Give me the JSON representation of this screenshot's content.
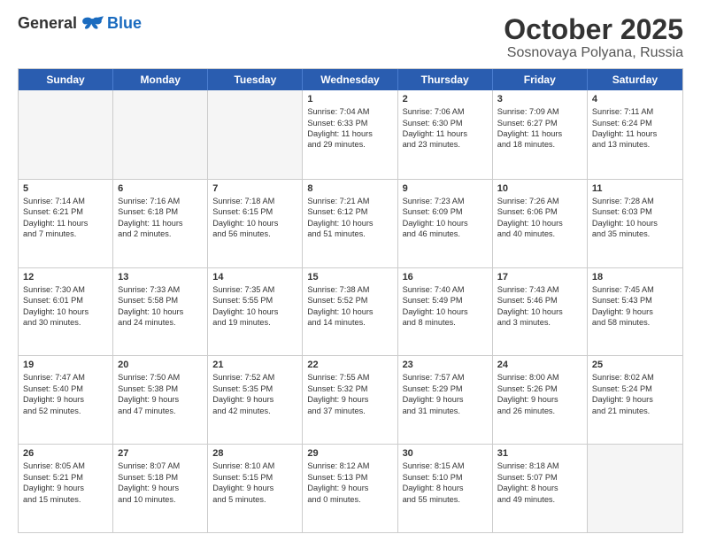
{
  "logo": {
    "general": "General",
    "blue": "Blue"
  },
  "header": {
    "month": "October 2025",
    "location": "Sosnovaya Polyana, Russia"
  },
  "weekdays": [
    "Sunday",
    "Monday",
    "Tuesday",
    "Wednesday",
    "Thursday",
    "Friday",
    "Saturday"
  ],
  "rows": [
    [
      {
        "day": "",
        "lines": [],
        "empty": true
      },
      {
        "day": "",
        "lines": [],
        "empty": true
      },
      {
        "day": "",
        "lines": [],
        "empty": true
      },
      {
        "day": "1",
        "lines": [
          "Sunrise: 7:04 AM",
          "Sunset: 6:33 PM",
          "Daylight: 11 hours",
          "and 29 minutes."
        ],
        "empty": false
      },
      {
        "day": "2",
        "lines": [
          "Sunrise: 7:06 AM",
          "Sunset: 6:30 PM",
          "Daylight: 11 hours",
          "and 23 minutes."
        ],
        "empty": false
      },
      {
        "day": "3",
        "lines": [
          "Sunrise: 7:09 AM",
          "Sunset: 6:27 PM",
          "Daylight: 11 hours",
          "and 18 minutes."
        ],
        "empty": false
      },
      {
        "day": "4",
        "lines": [
          "Sunrise: 7:11 AM",
          "Sunset: 6:24 PM",
          "Daylight: 11 hours",
          "and 13 minutes."
        ],
        "empty": false
      }
    ],
    [
      {
        "day": "5",
        "lines": [
          "Sunrise: 7:14 AM",
          "Sunset: 6:21 PM",
          "Daylight: 11 hours",
          "and 7 minutes."
        ],
        "empty": false
      },
      {
        "day": "6",
        "lines": [
          "Sunrise: 7:16 AM",
          "Sunset: 6:18 PM",
          "Daylight: 11 hours",
          "and 2 minutes."
        ],
        "empty": false
      },
      {
        "day": "7",
        "lines": [
          "Sunrise: 7:18 AM",
          "Sunset: 6:15 PM",
          "Daylight: 10 hours",
          "and 56 minutes."
        ],
        "empty": false
      },
      {
        "day": "8",
        "lines": [
          "Sunrise: 7:21 AM",
          "Sunset: 6:12 PM",
          "Daylight: 10 hours",
          "and 51 minutes."
        ],
        "empty": false
      },
      {
        "day": "9",
        "lines": [
          "Sunrise: 7:23 AM",
          "Sunset: 6:09 PM",
          "Daylight: 10 hours",
          "and 46 minutes."
        ],
        "empty": false
      },
      {
        "day": "10",
        "lines": [
          "Sunrise: 7:26 AM",
          "Sunset: 6:06 PM",
          "Daylight: 10 hours",
          "and 40 minutes."
        ],
        "empty": false
      },
      {
        "day": "11",
        "lines": [
          "Sunrise: 7:28 AM",
          "Sunset: 6:03 PM",
          "Daylight: 10 hours",
          "and 35 minutes."
        ],
        "empty": false
      }
    ],
    [
      {
        "day": "12",
        "lines": [
          "Sunrise: 7:30 AM",
          "Sunset: 6:01 PM",
          "Daylight: 10 hours",
          "and 30 minutes."
        ],
        "empty": false
      },
      {
        "day": "13",
        "lines": [
          "Sunrise: 7:33 AM",
          "Sunset: 5:58 PM",
          "Daylight: 10 hours",
          "and 24 minutes."
        ],
        "empty": false
      },
      {
        "day": "14",
        "lines": [
          "Sunrise: 7:35 AM",
          "Sunset: 5:55 PM",
          "Daylight: 10 hours",
          "and 19 minutes."
        ],
        "empty": false
      },
      {
        "day": "15",
        "lines": [
          "Sunrise: 7:38 AM",
          "Sunset: 5:52 PM",
          "Daylight: 10 hours",
          "and 14 minutes."
        ],
        "empty": false
      },
      {
        "day": "16",
        "lines": [
          "Sunrise: 7:40 AM",
          "Sunset: 5:49 PM",
          "Daylight: 10 hours",
          "and 8 minutes."
        ],
        "empty": false
      },
      {
        "day": "17",
        "lines": [
          "Sunrise: 7:43 AM",
          "Sunset: 5:46 PM",
          "Daylight: 10 hours",
          "and 3 minutes."
        ],
        "empty": false
      },
      {
        "day": "18",
        "lines": [
          "Sunrise: 7:45 AM",
          "Sunset: 5:43 PM",
          "Daylight: 9 hours",
          "and 58 minutes."
        ],
        "empty": false
      }
    ],
    [
      {
        "day": "19",
        "lines": [
          "Sunrise: 7:47 AM",
          "Sunset: 5:40 PM",
          "Daylight: 9 hours",
          "and 52 minutes."
        ],
        "empty": false
      },
      {
        "day": "20",
        "lines": [
          "Sunrise: 7:50 AM",
          "Sunset: 5:38 PM",
          "Daylight: 9 hours",
          "and 47 minutes."
        ],
        "empty": false
      },
      {
        "day": "21",
        "lines": [
          "Sunrise: 7:52 AM",
          "Sunset: 5:35 PM",
          "Daylight: 9 hours",
          "and 42 minutes."
        ],
        "empty": false
      },
      {
        "day": "22",
        "lines": [
          "Sunrise: 7:55 AM",
          "Sunset: 5:32 PM",
          "Daylight: 9 hours",
          "and 37 minutes."
        ],
        "empty": false
      },
      {
        "day": "23",
        "lines": [
          "Sunrise: 7:57 AM",
          "Sunset: 5:29 PM",
          "Daylight: 9 hours",
          "and 31 minutes."
        ],
        "empty": false
      },
      {
        "day": "24",
        "lines": [
          "Sunrise: 8:00 AM",
          "Sunset: 5:26 PM",
          "Daylight: 9 hours",
          "and 26 minutes."
        ],
        "empty": false
      },
      {
        "day": "25",
        "lines": [
          "Sunrise: 8:02 AM",
          "Sunset: 5:24 PM",
          "Daylight: 9 hours",
          "and 21 minutes."
        ],
        "empty": false
      }
    ],
    [
      {
        "day": "26",
        "lines": [
          "Sunrise: 8:05 AM",
          "Sunset: 5:21 PM",
          "Daylight: 9 hours",
          "and 15 minutes."
        ],
        "empty": false
      },
      {
        "day": "27",
        "lines": [
          "Sunrise: 8:07 AM",
          "Sunset: 5:18 PM",
          "Daylight: 9 hours",
          "and 10 minutes."
        ],
        "empty": false
      },
      {
        "day": "28",
        "lines": [
          "Sunrise: 8:10 AM",
          "Sunset: 5:15 PM",
          "Daylight: 9 hours",
          "and 5 minutes."
        ],
        "empty": false
      },
      {
        "day": "29",
        "lines": [
          "Sunrise: 8:12 AM",
          "Sunset: 5:13 PM",
          "Daylight: 9 hours",
          "and 0 minutes."
        ],
        "empty": false
      },
      {
        "day": "30",
        "lines": [
          "Sunrise: 8:15 AM",
          "Sunset: 5:10 PM",
          "Daylight: 8 hours",
          "and 55 minutes."
        ],
        "empty": false
      },
      {
        "day": "31",
        "lines": [
          "Sunrise: 8:18 AM",
          "Sunset: 5:07 PM",
          "Daylight: 8 hours",
          "and 49 minutes."
        ],
        "empty": false
      },
      {
        "day": "",
        "lines": [],
        "empty": true
      }
    ]
  ]
}
